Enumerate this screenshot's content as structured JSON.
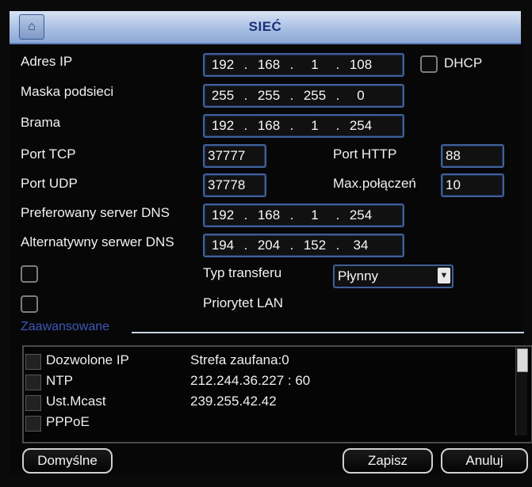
{
  "window": {
    "title": "SIEĆ",
    "title_icon": "network-icon"
  },
  "fields": {
    "adres_ip": {
      "label": "Adres IP",
      "octets": [
        "192",
        "168",
        "1",
        "108"
      ]
    },
    "maska": {
      "label": "Maska podsieci",
      "octets": [
        "255",
        "255",
        "255",
        "0"
      ]
    },
    "brama": {
      "label": "Brama",
      "octets": [
        "192",
        "168",
        "1",
        "254"
      ]
    },
    "port_tcp": {
      "label": "Port TCP",
      "value": "37777"
    },
    "port_http": {
      "label": "Port HTTP",
      "value": "88"
    },
    "port_udp": {
      "label": "Port UDP",
      "value": "37778"
    },
    "max_polaczen": {
      "label": "Max.połączeń",
      "value": "10"
    },
    "dns_pref": {
      "label": "Preferowany server DNS",
      "octets": [
        "192",
        "168",
        "1",
        "254"
      ]
    },
    "dns_alt": {
      "label": "Alternatywny serwer DNS",
      "octets": [
        "194",
        "204",
        "152",
        "34"
      ]
    }
  },
  "dhcp": {
    "label": "DHCP",
    "checked": false
  },
  "transfer": {
    "label": "Typ transferu",
    "selected": "Płynny"
  },
  "priorytet": {
    "label": "Priorytet LAN"
  },
  "advanced": {
    "title": "Zaawansowane",
    "rows": [
      {
        "name": "Dozwolone IP",
        "value": "Strefa zaufana:0"
      },
      {
        "name": "NTP",
        "value": "212.244.36.227 : 60"
      },
      {
        "name": "Ust.Mcast",
        "value": "239.255.42.42"
      },
      {
        "name": "PPPoE",
        "value": ""
      }
    ]
  },
  "buttons": {
    "default": "Domyślne",
    "save": "Zapisz",
    "cancel": "Anuluj"
  },
  "colors": {
    "titlebar": "#a9bfe3",
    "title_text": "#1a2f7a",
    "field_border": "#3f5f9a",
    "section_text": "#3e58b8"
  }
}
